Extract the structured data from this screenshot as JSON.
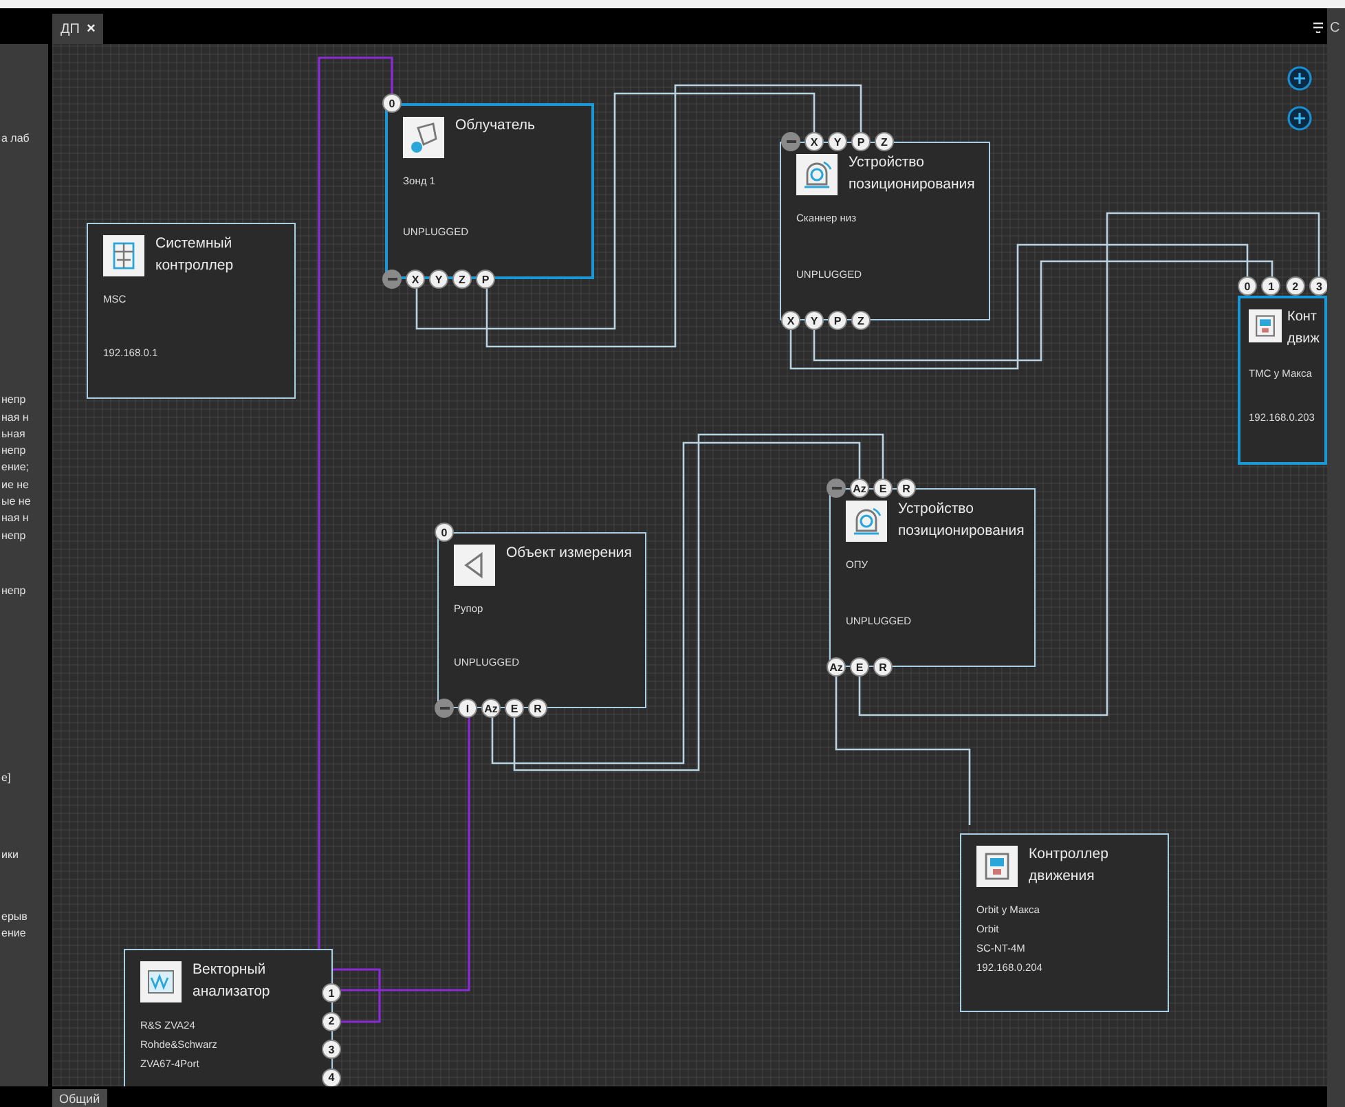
{
  "left_panel": {
    "groups": [
      [
        "а лаб"
      ],
      [
        "непр",
        "ная н",
        "ьная",
        "непр",
        "ение;",
        "ие не",
        "ые не",
        "ная н",
        "непр"
      ],
      [
        "непр"
      ],
      [
        "е]"
      ],
      [
        "ики"
      ],
      [
        "ерыв",
        "ение"
      ]
    ]
  },
  "tabs": [
    {
      "label": "ДП",
      "close": "×",
      "selected": true
    }
  ],
  "right_strip": {
    "label": "С"
  },
  "bottom_tabs": [
    {
      "label": "Общий",
      "selected": true
    }
  ],
  "nodes": [
    {
      "kind": "feed",
      "selected": true,
      "title": [
        "Облучатель"
      ],
      "details": [
        "Зонд 1"
      ],
      "footer": "UNPLUGGED",
      "ports_top": [
        {
          "kind": "label",
          "label": "0"
        }
      ],
      "ports_bottom": [
        {
          "kind": "blank"
        },
        {
          "kind": "label",
          "label": "X"
        },
        {
          "kind": "label",
          "label": "Y"
        },
        {
          "kind": "label",
          "label": "Z"
        },
        {
          "kind": "label",
          "label": "P"
        }
      ]
    },
    {
      "kind": "controller",
      "selected": false,
      "title": [
        "Системный",
        "контроллер"
      ],
      "details": [
        "MSC"
      ],
      "footer": "192.168.0.1"
    },
    {
      "kind": "positioner",
      "selected": false,
      "title": [
        "Устройство",
        "позиционирования"
      ],
      "details": [
        "Сканнер низ"
      ],
      "footer": "UNPLUGGED",
      "ports_top": [
        {
          "kind": "blank"
        },
        {
          "kind": "label",
          "label": "X"
        },
        {
          "kind": "label",
          "label": "Y"
        },
        {
          "kind": "label",
          "label": "P"
        },
        {
          "kind": "label",
          "label": "Z"
        }
      ],
      "ports_bottom": [
        {
          "kind": "label",
          "label": "X"
        },
        {
          "kind": "label",
          "label": "Y"
        },
        {
          "kind": "label",
          "label": "P"
        },
        {
          "kind": "label",
          "label": "Z"
        }
      ]
    },
    {
      "kind": "motion",
      "selected": true,
      "title": [
        "Конт",
        "движ"
      ],
      "details": [
        "ТМС у Макса"
      ],
      "footer": "192.168.0.203",
      "ports_top": [
        {
          "kind": "label",
          "label": "0"
        },
        {
          "kind": "label",
          "label": "1"
        },
        {
          "kind": "label",
          "label": "2"
        },
        {
          "kind": "label",
          "label": "3"
        }
      ]
    },
    {
      "kind": "object",
      "selected": false,
      "title": [
        "Объект измерения"
      ],
      "details": [
        "Рупор"
      ],
      "footer": "UNPLUGGED",
      "ports_top": [
        {
          "kind": "label",
          "label": "0"
        }
      ],
      "ports_bottom": [
        {
          "kind": "blank"
        },
        {
          "kind": "label",
          "label": "I"
        },
        {
          "kind": "label",
          "label": "Az"
        },
        {
          "kind": "label",
          "label": "E"
        },
        {
          "kind": "label",
          "label": "R"
        }
      ]
    },
    {
      "kind": "positioner",
      "selected": false,
      "title": [
        "Устройство",
        "позиционирования"
      ],
      "details": [
        "ОПУ"
      ],
      "footer": "UNPLUGGED",
      "ports_top": [
        {
          "kind": "blank"
        },
        {
          "kind": "label",
          "label": "Az"
        },
        {
          "kind": "label",
          "label": "E"
        },
        {
          "kind": "label",
          "label": "R"
        }
      ],
      "ports_bottom": [
        {
          "kind": "label",
          "label": "Az"
        },
        {
          "kind": "label",
          "label": "E"
        },
        {
          "kind": "label",
          "label": "R"
        }
      ]
    },
    {
      "kind": "motion",
      "selected": false,
      "title": [
        "Контроллер",
        "движения"
      ],
      "details": [
        "Orbit у Макса",
        "Orbit",
        "SC-NT-4M",
        "192.168.0.204"
      ]
    },
    {
      "kind": "analyzer",
      "selected": false,
      "title": [
        "Векторный",
        "анализатор"
      ],
      "details": [
        "R&S ZVA24",
        "Rohde&Schwarz",
        "ZVA67-4Port"
      ],
      "ports_right": [
        {
          "kind": "label",
          "label": "1"
        },
        {
          "kind": "label",
          "label": "2"
        },
        {
          "kind": "label",
          "label": "3"
        },
        {
          "kind": "label",
          "label": "4"
        }
      ]
    }
  ]
}
